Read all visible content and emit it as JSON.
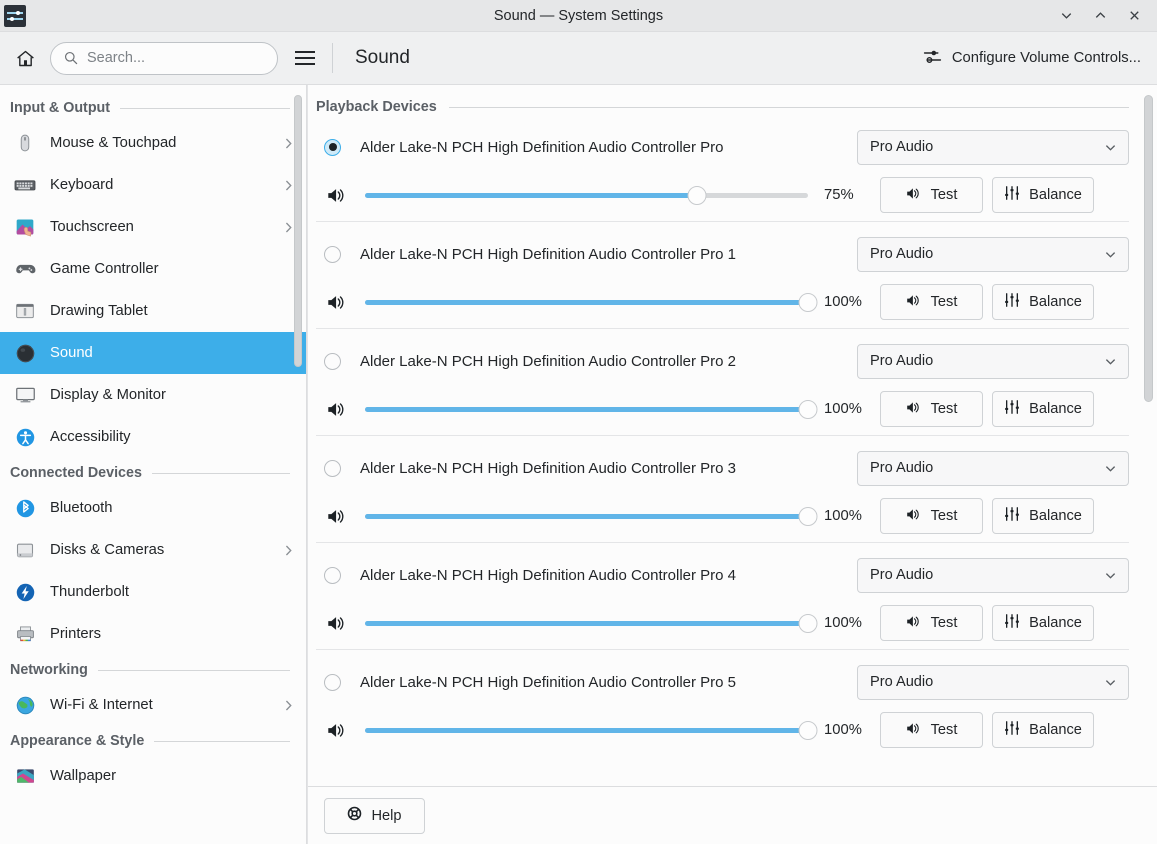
{
  "window": {
    "title": "Sound — System Settings",
    "app_icon": "audio-volume-sliders-icon",
    "controls": {
      "minimize": "chevron-down-icon",
      "maximize": "chevron-up-icon",
      "close": "close-icon"
    }
  },
  "toolbar": {
    "home_icon": "home-icon",
    "search_placeholder": "Search...",
    "search_value": "",
    "menu_icon": "hamburger-menu-icon",
    "page_title": "Sound",
    "configure_label": "Configure Volume Controls...",
    "configure_icon": "sliders-icon"
  },
  "sidebar": {
    "groups": [
      {
        "title": "Input & Output",
        "items": [
          {
            "label": "Mouse & Touchpad",
            "icon": "mouse-icon",
            "chevron": true,
            "selected": false
          },
          {
            "label": "Keyboard",
            "icon": "keyboard-icon",
            "chevron": true,
            "selected": false
          },
          {
            "label": "Touchscreen",
            "icon": "touchscreen-icon",
            "chevron": true,
            "selected": false
          },
          {
            "label": "Game Controller",
            "icon": "gamepad-icon",
            "chevron": false,
            "selected": false
          },
          {
            "label": "Drawing Tablet",
            "icon": "drawing-tablet-icon",
            "chevron": false,
            "selected": false
          },
          {
            "label": "Sound",
            "icon": "sound-icon",
            "chevron": false,
            "selected": true
          },
          {
            "label": "Display & Monitor",
            "icon": "monitor-icon",
            "chevron": false,
            "selected": false
          },
          {
            "label": "Accessibility",
            "icon": "accessibility-icon",
            "chevron": false,
            "selected": false
          }
        ]
      },
      {
        "title": "Connected Devices",
        "items": [
          {
            "label": "Bluetooth",
            "icon": "bluetooth-icon",
            "chevron": false,
            "selected": false
          },
          {
            "label": "Disks & Cameras",
            "icon": "disk-icon",
            "chevron": true,
            "selected": false
          },
          {
            "label": "Thunderbolt",
            "icon": "thunderbolt-icon",
            "chevron": false,
            "selected": false
          },
          {
            "label": "Printers",
            "icon": "printer-icon",
            "chevron": false,
            "selected": false
          }
        ]
      },
      {
        "title": "Networking",
        "items": [
          {
            "label": "Wi-Fi & Internet",
            "icon": "globe-icon",
            "chevron": true,
            "selected": false
          }
        ]
      },
      {
        "title": "Appearance & Style",
        "items": [
          {
            "label": "Wallpaper",
            "icon": "wallpaper-icon",
            "chevron": false,
            "selected": false
          }
        ]
      }
    ]
  },
  "main": {
    "section_title": "Playback Devices",
    "buttons": {
      "test": "Test",
      "balance": "Balance",
      "help": "Help"
    },
    "icons": {
      "test": "speaker-icon",
      "balance": "balance-sliders-icon",
      "help": "lifebuoy-icon",
      "volume": "volume-icon"
    },
    "devices": [
      {
        "name": "Alder Lake-N PCH High Definition Audio Controller Pro",
        "profile": "Pro Audio",
        "volume": 75,
        "volume_label": "75%",
        "selected": true
      },
      {
        "name": "Alder Lake-N PCH High Definition Audio Controller Pro 1",
        "profile": "Pro Audio",
        "volume": 100,
        "volume_label": "100%",
        "selected": false
      },
      {
        "name": "Alder Lake-N PCH High Definition Audio Controller Pro 2",
        "profile": "Pro Audio",
        "volume": 100,
        "volume_label": "100%",
        "selected": false
      },
      {
        "name": "Alder Lake-N PCH High Definition Audio Controller Pro 3",
        "profile": "Pro Audio",
        "volume": 100,
        "volume_label": "100%",
        "selected": false
      },
      {
        "name": "Alder Lake-N PCH High Definition Audio Controller Pro 4",
        "profile": "Pro Audio",
        "volume": 100,
        "volume_label": "100%",
        "selected": false
      },
      {
        "name": "Alder Lake-N PCH High Definition Audio Controller Pro 5",
        "profile": "Pro Audio",
        "volume": 100,
        "volume_label": "100%",
        "selected": false
      }
    ]
  },
  "colors": {
    "accent": "#3daee9",
    "slider_fill": "#61b5e8",
    "window_bg": "#eff0f1",
    "content_bg": "#fcfcfc",
    "text": "#232629"
  }
}
